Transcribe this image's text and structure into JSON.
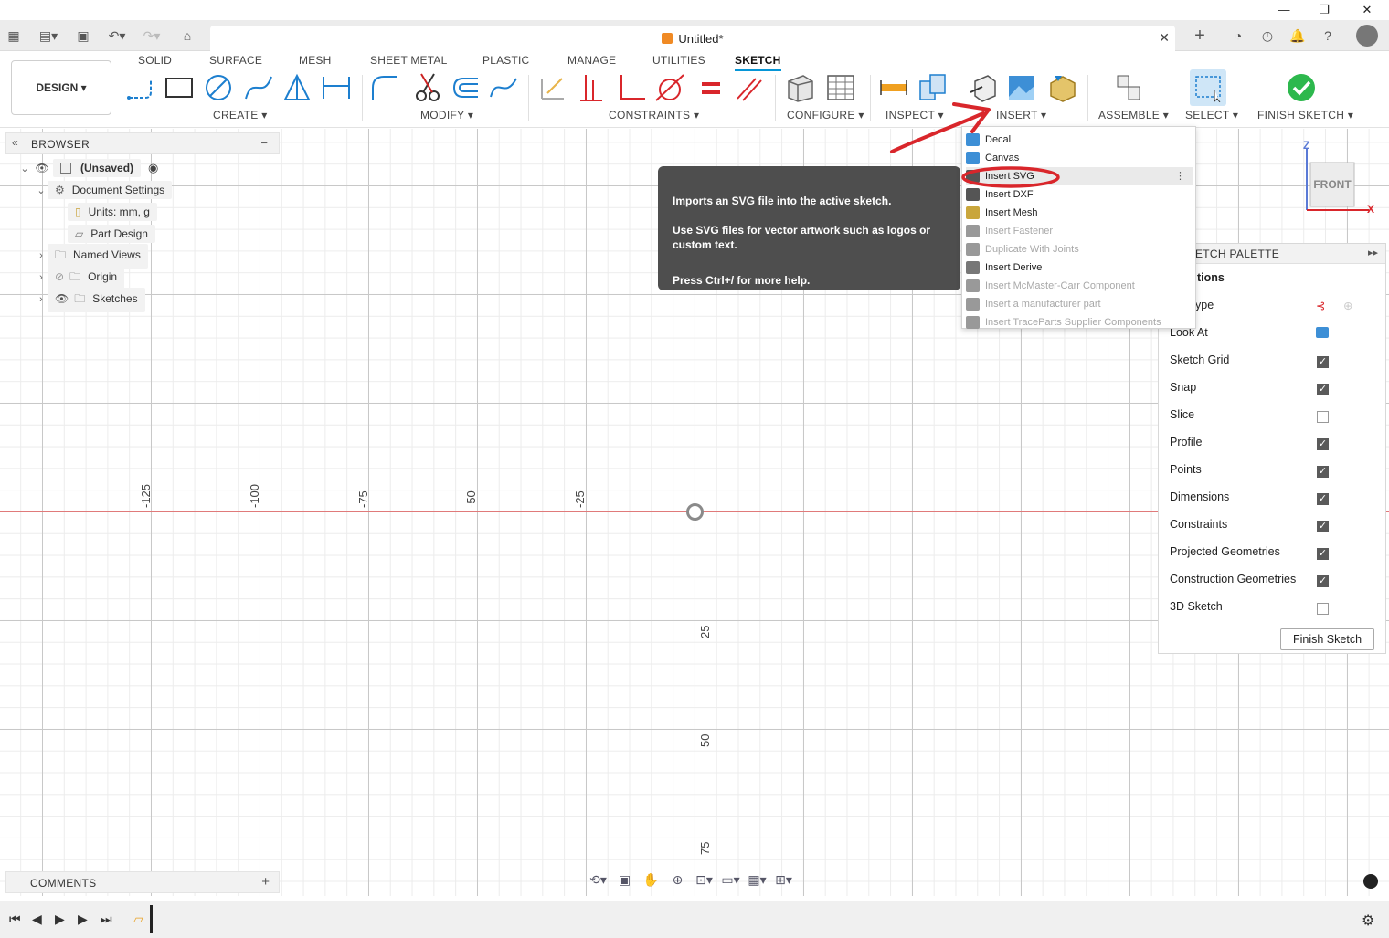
{
  "window": {
    "minimize": "—",
    "maximize": "❐",
    "close": "✕"
  },
  "tab": {
    "title": "Untitled*",
    "close": "✕"
  },
  "toolbar": {
    "design_label": "DESIGN ▾",
    "workspace_tabs": [
      "SOLID",
      "SURFACE",
      "MESH",
      "SHEET METAL",
      "PLASTIC",
      "MANAGE",
      "UTILITIES",
      "SKETCH"
    ],
    "active_tab": "SKETCH",
    "groups": {
      "create": "CREATE ▾",
      "modify": "MODIFY ▾",
      "constraints": "CONSTRAINTS ▾",
      "configure": "CONFIGURE ▾",
      "inspect": "INSPECT ▾",
      "insert": "INSERT ▾",
      "assemble": "ASSEMBLE ▾",
      "select": "SELECT ▾",
      "finish_sketch": "FINISH SKETCH ▾"
    }
  },
  "browser": {
    "title": "BROWSER",
    "collapse": "−",
    "tree": {
      "root": "(Unsaved)",
      "document_settings": "Document Settings",
      "units": "Units: mm, g",
      "part_design": "Part Design",
      "named_views": "Named Views",
      "origin": "Origin",
      "sketches": "Sketches"
    }
  },
  "canvas": {
    "x_ticks": [
      "-125",
      "-100",
      "-75",
      "-50",
      "-25"
    ],
    "y_ticks": [
      "25",
      "50",
      "75"
    ]
  },
  "viewcube": {
    "face": "FRONT",
    "z": "Z",
    "x": "X"
  },
  "insert_menu": {
    "items": [
      {
        "label": "Decal",
        "enabled": true,
        "color": "#3d8fd6"
      },
      {
        "label": "Canvas",
        "enabled": true,
        "color": "#3d8fd6"
      },
      {
        "label": "Insert SVG",
        "enabled": true,
        "color": "#555555",
        "highlighted": true
      },
      {
        "label": "Insert DXF",
        "enabled": true,
        "color": "#555555"
      },
      {
        "label": "Insert Mesh",
        "enabled": true,
        "color": "#c9a63c"
      },
      {
        "label": "Insert Fastener",
        "enabled": false,
        "color": "#999999"
      },
      {
        "label": "Duplicate With Joints",
        "enabled": false,
        "color": "#999999"
      },
      {
        "label": "Insert Derive",
        "enabled": true,
        "color": "#777777"
      },
      {
        "label": "Insert McMaster-Carr Component",
        "enabled": false,
        "color": "#999999"
      },
      {
        "label": "Insert a manufacturer part",
        "enabled": false,
        "color": "#999999"
      },
      {
        "label": "Insert TraceParts Supplier Components",
        "enabled": false,
        "color": "#999999"
      }
    ],
    "more": "⋮"
  },
  "tooltip": {
    "line1": "Imports an SVG file into the active sketch.",
    "line2": "Use SVG files for vector artwork such as logos or custom text.",
    "help": "Press Ctrl+/ for more help."
  },
  "sketch_palette": {
    "title": "ETCH PALETTE",
    "expand": "▸▸",
    "section": "tions",
    "linetype": "ype",
    "options": [
      {
        "label": "Look At",
        "kind": "icon"
      },
      {
        "label": "Sketch Grid",
        "checked": true
      },
      {
        "label": "Snap",
        "checked": true
      },
      {
        "label": "Slice",
        "checked": false
      },
      {
        "label": "Profile",
        "checked": true
      },
      {
        "label": "Points",
        "checked": true
      },
      {
        "label": "Dimensions",
        "checked": true
      },
      {
        "label": "Constraints",
        "checked": true
      },
      {
        "label": "Projected Geometries",
        "checked": true
      },
      {
        "label": "Construction Geometries",
        "checked": true
      },
      {
        "label": "3D Sketch",
        "checked": false
      }
    ],
    "finish_button": "Finish Sketch"
  },
  "comments": {
    "title": "COMMENTS",
    "add": "+"
  },
  "colors": {
    "accent": "#0696d7",
    "x_axis": "#e07a7a",
    "y_axis": "#58d058",
    "finish_green": "#2db84d",
    "annotation_red": "#d9262b"
  }
}
